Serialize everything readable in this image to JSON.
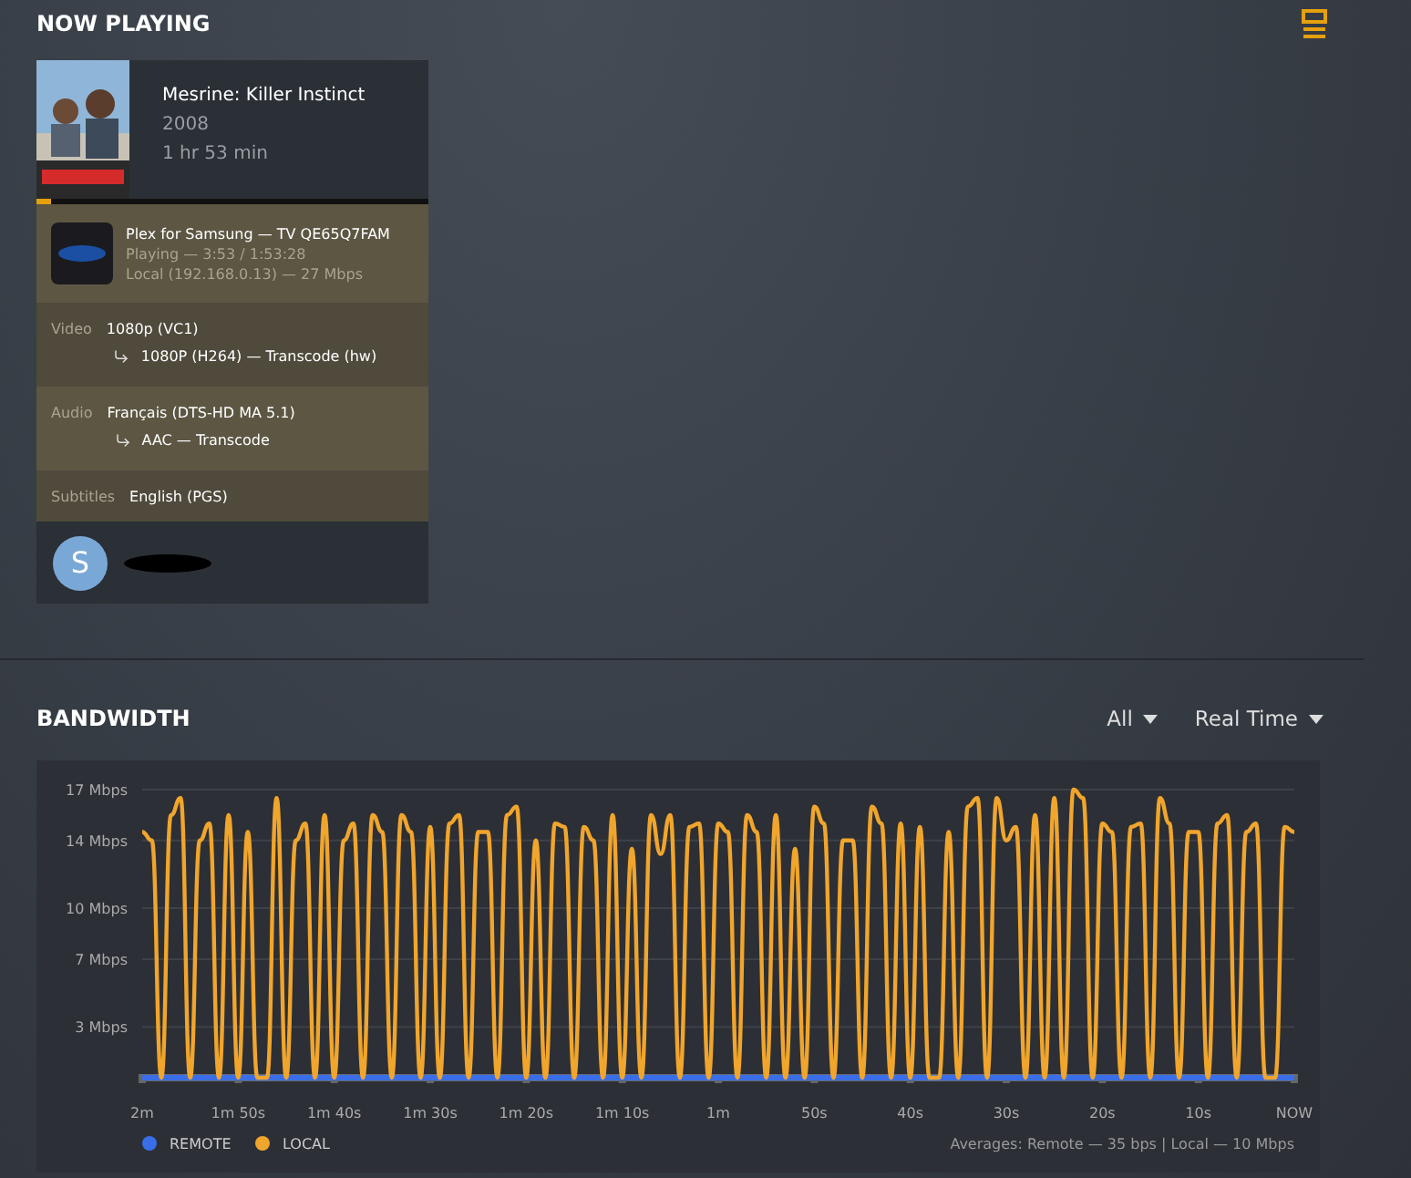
{
  "now_playing": {
    "title": "NOW PLAYING"
  },
  "session": {
    "title": "Mesrine: Killer Instinct",
    "year": "2008",
    "duration": "1 hr 53 min",
    "progress": {
      "level": 0.035
    },
    "player": {
      "line": "Plex for Samsung  —  TV QE65Q7FAM",
      "state": "Playing — 3:53 / 1:53:28",
      "network": "Local (192.168.0.13) — 27 Mbps"
    },
    "streams": [
      {
        "label": "Video",
        "source": "1080p (VC1)",
        "target": "1080P (H264) — Transcode (hw)"
      },
      {
        "label": "Audio",
        "source": "Français (DTS-HD MA 5.1)",
        "target": "AAC — Transcode"
      },
      {
        "label": "Subtitles",
        "source": "English (PGS)"
      }
    ],
    "user": {
      "avatar_letter": "S"
    }
  },
  "bandwidth": {
    "title": "BANDWIDTH",
    "filters": [
      "All",
      "Real Time"
    ],
    "chart_data": {
      "type": "line",
      "ylim": [
        0,
        17
      ],
      "grid": true,
      "legend": true,
      "categories": [
        "2m",
        null,
        null,
        null,
        null,
        null,
        null,
        null,
        null,
        null,
        "1m 50s",
        null,
        null,
        null,
        null,
        null,
        null,
        null,
        null,
        null,
        "1m 40s",
        null,
        null,
        null,
        null,
        null,
        null,
        null,
        null,
        null,
        "1m 30s",
        null,
        null,
        null,
        null,
        null,
        null,
        null,
        null,
        null,
        "1m 20s",
        null,
        null,
        null,
        null,
        null,
        null,
        null,
        null,
        null,
        "1m 10s",
        null,
        null,
        null,
        null,
        null,
        null,
        null,
        null,
        null,
        "1m",
        null,
        null,
        null,
        null,
        null,
        null,
        null,
        null,
        null,
        "50s",
        null,
        null,
        null,
        null,
        null,
        null,
        null,
        null,
        null,
        "40s",
        null,
        null,
        null,
        null,
        null,
        null,
        null,
        null,
        null,
        "30s",
        null,
        null,
        null,
        null,
        null,
        null,
        null,
        null,
        null,
        "20s",
        null,
        null,
        null,
        null,
        null,
        null,
        null,
        null,
        null,
        "10s",
        null,
        null,
        null,
        null,
        null,
        null,
        null,
        null,
        null,
        "NOW"
      ],
      "yticks": [
        {
          "value": 3,
          "label": "3 Mbps"
        },
        {
          "value": 7,
          "label": "7 Mbps"
        },
        {
          "value": 10,
          "label": "10 Mbps"
        },
        {
          "value": 14,
          "label": "14 Mbps"
        },
        {
          "value": 17,
          "label": "17 Mbps"
        }
      ],
      "series": [
        {
          "name": "REMOTE",
          "color": "#3a6ee8",
          "values": [
            0,
            0,
            0,
            0,
            0,
            0,
            0,
            0,
            0,
            0,
            0,
            0,
            0,
            0,
            0,
            0,
            0,
            0,
            0,
            0,
            0,
            0,
            0,
            0,
            0,
            0,
            0,
            0,
            0,
            0,
            0,
            0,
            0,
            0,
            0,
            0,
            0,
            0,
            0,
            0,
            0,
            0,
            0,
            0,
            0,
            0,
            0,
            0,
            0,
            0,
            0,
            0,
            0,
            0,
            0,
            0,
            0,
            0,
            0,
            0,
            0,
            0,
            0,
            0,
            0,
            0,
            0,
            0,
            0,
            0,
            0,
            0,
            0,
            0,
            0,
            0,
            0,
            0,
            0,
            0,
            0,
            0,
            0,
            0,
            0,
            0,
            0,
            0,
            0,
            0,
            0,
            0,
            0,
            0,
            0,
            0,
            0,
            0,
            0,
            0,
            0,
            0,
            0,
            0,
            0,
            0,
            0,
            0,
            0,
            0,
            0,
            0,
            0,
            0,
            0,
            0,
            0,
            0,
            0,
            0,
            0
          ]
        },
        {
          "name": "LOCAL",
          "color": "#f0a52c",
          "values": [
            14.5,
            14,
            0,
            15.5,
            16.5,
            0,
            14,
            15,
            0,
            15.5,
            0,
            14.5,
            0,
            0,
            16.5,
            0,
            14,
            15,
            0,
            15.5,
            0,
            14,
            15,
            0,
            15.5,
            14.5,
            0,
            15.5,
            14.5,
            0,
            14.8,
            0,
            15,
            15.5,
            0,
            14.5,
            14.5,
            0,
            15.5,
            16,
            0,
            14,
            0,
            15,
            14.8,
            0,
            14.8,
            14,
            0,
            15.5,
            0,
            13.5,
            0,
            15.5,
            13.2,
            15.5,
            0,
            14.8,
            15,
            0,
            15,
            14.5,
            0,
            15.5,
            14.5,
            0,
            15.5,
            0,
            13.5,
            0,
            16,
            15,
            0,
            14,
            14,
            0,
            16,
            15,
            0,
            15,
            0,
            14.8,
            0,
            0,
            14.5,
            0,
            16,
            16.5,
            0,
            16.5,
            14,
            14.8,
            0,
            15.5,
            0,
            16.5,
            0,
            17,
            16.5,
            0,
            15,
            14.5,
            0,
            14.8,
            15,
            0,
            16.5,
            15,
            0,
            14.5,
            14.5,
            0,
            15,
            15.5,
            0,
            14.5,
            15,
            0,
            0,
            14.8,
            14.5
          ]
        }
      ]
    },
    "averages": "Averages: Remote — 35 bps | Local — 10 Mbps"
  }
}
